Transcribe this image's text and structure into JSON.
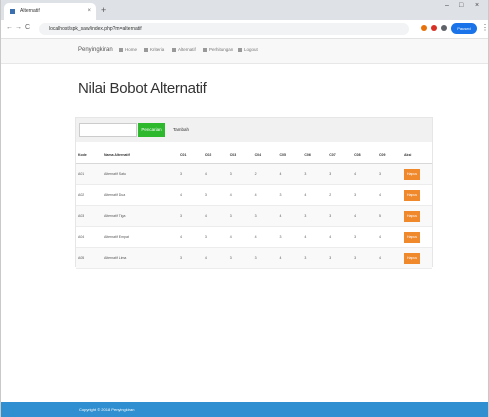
{
  "browser": {
    "tab_title": "Alternatif",
    "tab_close": "×",
    "new_tab": "+",
    "minimize": "–",
    "maximize": "□",
    "close": "×",
    "back": "←",
    "forward": "→",
    "reload": "C",
    "url": "localhost/spk_saw/index.php?m=alternatif",
    "profile_label": "Paused",
    "menu": "⋮"
  },
  "navbar": {
    "brand": "Penyingkiran",
    "items": [
      "Home",
      "Kriteria",
      "Alternatif",
      "Perhitungan",
      "Logout"
    ]
  },
  "page": {
    "title": "Nilai Bobot Alternatif"
  },
  "toolbar": {
    "search_placeholder": "",
    "search_button": "Pencarian",
    "add_button": "Tambah"
  },
  "table": {
    "headers": [
      "Kode",
      "Nama Alternatif",
      "C01",
      "C02",
      "C03",
      "C04",
      "C05",
      "C06",
      "C07",
      "C08",
      "C09",
      "Aksi"
    ],
    "rows": [
      {
        "kode": "A01",
        "nama": "Alternatif Satu",
        "values": [
          "3",
          "4",
          "3",
          "2",
          "4",
          "3",
          "3",
          "4",
          "3"
        ],
        "action": "Hapus"
      },
      {
        "kode": "A02",
        "nama": "Alternatif Dua",
        "values": [
          "4",
          "3",
          "4",
          "4",
          "3",
          "4",
          "2",
          "3",
          "4"
        ],
        "action": "Hapus"
      },
      {
        "kode": "A03",
        "nama": "Alternatif Tiga",
        "values": [
          "3",
          "4",
          "3",
          "3",
          "4",
          "3",
          "3",
          "4",
          "5"
        ],
        "action": "Hapus"
      },
      {
        "kode": "A04",
        "nama": "Alternatif Empat",
        "values": [
          "4",
          "3",
          "4",
          "4",
          "3",
          "4",
          "4",
          "3",
          "4"
        ],
        "action": "Hapus"
      },
      {
        "kode": "A05",
        "nama": "Alternatif Lima",
        "values": [
          "3",
          "4",
          "3",
          "3",
          "4",
          "3",
          "3",
          "3",
          "4"
        ],
        "action": "Hapus"
      }
    ]
  },
  "footer": {
    "text": "Copyright © 2018 Penyingkiran"
  },
  "colors": {
    "accent_green": "#2eb82e",
    "delete_orange": "#f0882c",
    "footer_blue": "#2f8fd0"
  }
}
